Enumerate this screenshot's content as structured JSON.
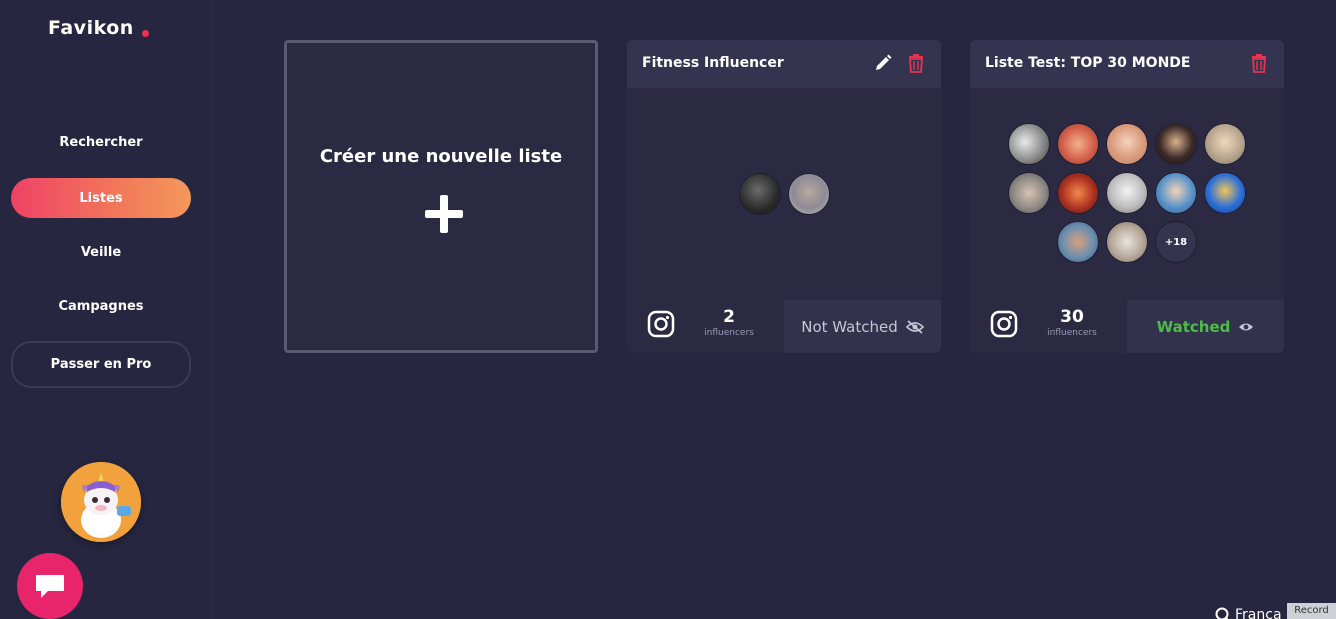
{
  "app": {
    "logo_text": "Favikon"
  },
  "sidebar": {
    "items": [
      {
        "label": "Rechercher"
      },
      {
        "label": "Listes"
      },
      {
        "label": "Veille"
      },
      {
        "label": "Campagnes"
      }
    ],
    "pro_label": "Passer en Pro"
  },
  "create": {
    "title": "Créer une nouvelle liste"
  },
  "lists": [
    {
      "title": "Fitness Influencer",
      "count": "2",
      "count_label": "influencers",
      "watch_label": "Not Watched",
      "watched": false
    },
    {
      "title": "Liste Test: TOP 30 MONDE",
      "count": "30",
      "count_label": "influencers",
      "watch_label": "Watched",
      "watched": true,
      "more_label": "+18"
    }
  ],
  "footer": {
    "language": "Franca",
    "record_label": "Record"
  },
  "colors": {
    "background": "#262640",
    "card": "#2b2a42",
    "accent_start": "#ef4266",
    "accent_end": "#f3985a",
    "delete": "#e8324f",
    "watched": "#4dbb48"
  },
  "icons": [
    "plus-icon",
    "pencil-icon",
    "trash-icon",
    "instagram-icon",
    "eye-off-icon",
    "eye-icon",
    "chat-icon",
    "search-icon"
  ]
}
